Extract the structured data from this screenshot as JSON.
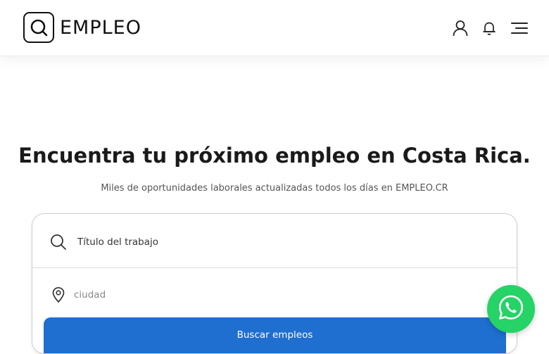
{
  "header": {
    "brand": "EMPLEO",
    "icons": [
      "user-icon",
      "bell-icon",
      "menu-icon"
    ]
  },
  "hero": {
    "title": "Encuentra tu próximo empleo en Costa Rica.",
    "subtitle": "Miles de oportunidades laborales actualizadas todos los días en EMPLEO.CR"
  },
  "search": {
    "job_placeholder": "Título del trabajo",
    "city_placeholder": "ciudad",
    "button_label": "Buscar empleos"
  },
  "colors": {
    "accent": "#1f6fd1",
    "whatsapp": "#25d366"
  }
}
